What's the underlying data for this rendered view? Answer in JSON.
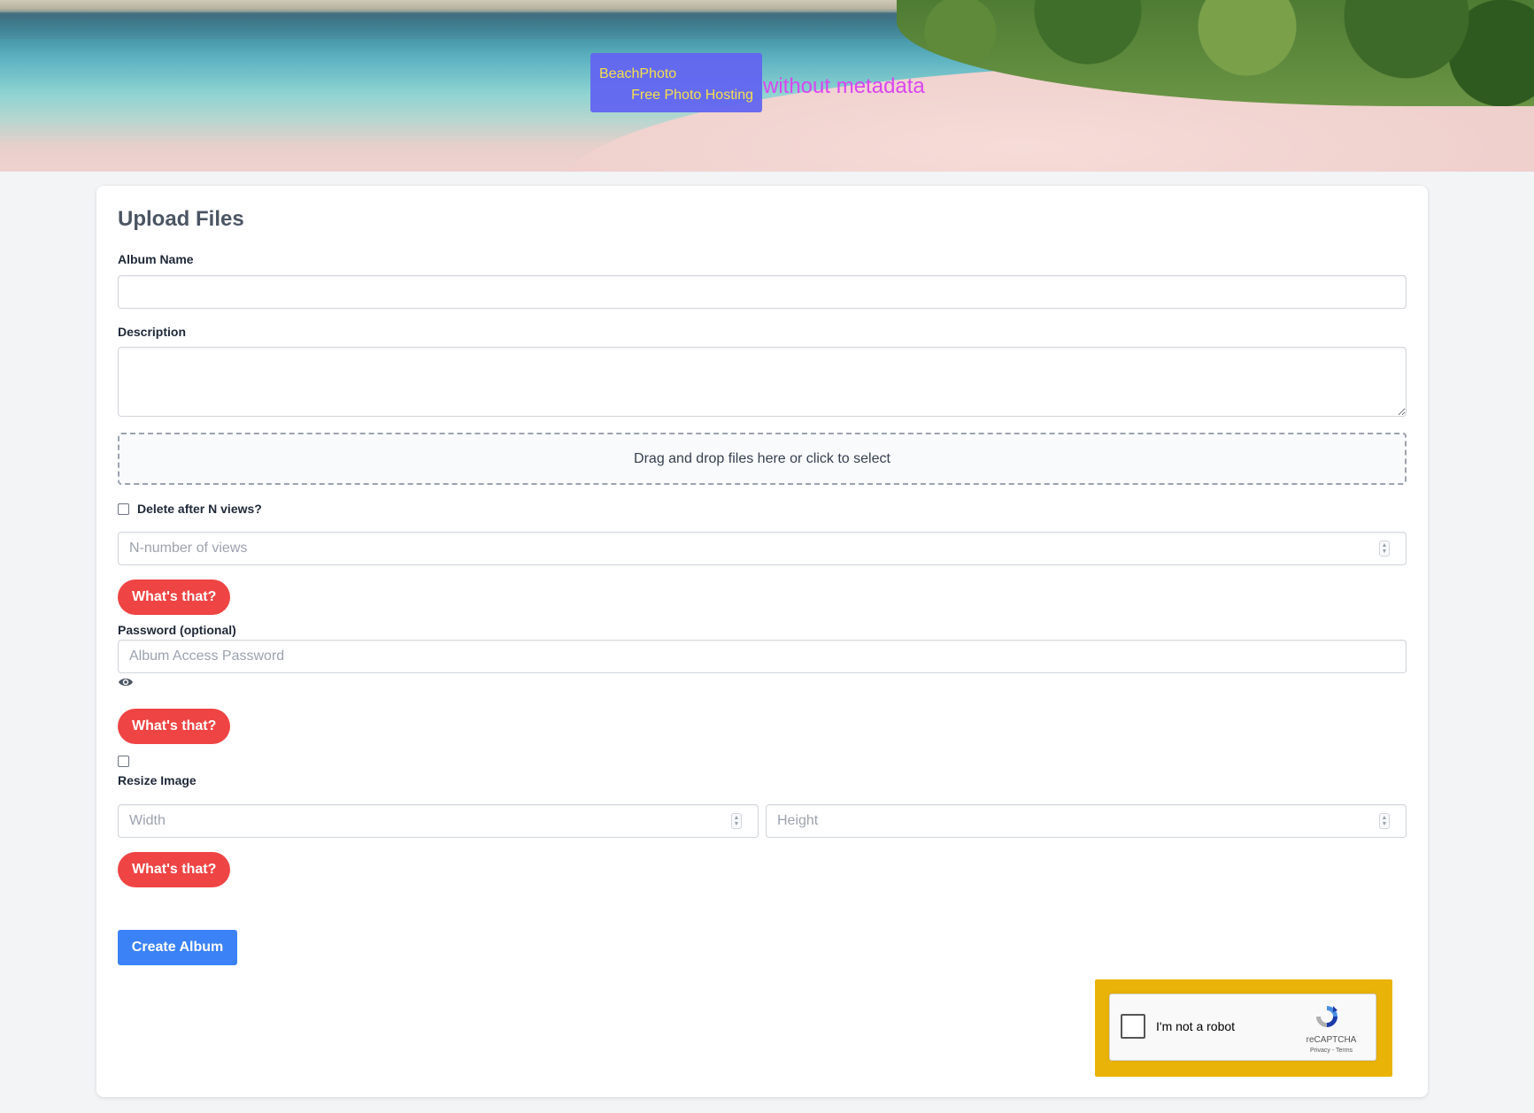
{
  "header": {
    "brand_name": "BeachPhoto",
    "brand_tagline": "Free Photo Hosting",
    "brand_suffix": "without metadata"
  },
  "form": {
    "title": "Upload Files",
    "album_name": {
      "label": "Album Name",
      "value": ""
    },
    "description": {
      "label": "Description",
      "value": ""
    },
    "dropzone_text": "Drag and drop files here or click to select",
    "delete_after": {
      "label": "Delete after N views?",
      "checked": false,
      "placeholder": "N-number of views"
    },
    "whats_that_label": "What's that?",
    "password": {
      "label": "Password (optional)",
      "placeholder": "Album Access Password"
    },
    "resize": {
      "label": "Resize Image",
      "checked": false,
      "width_placeholder": "Width",
      "height_placeholder": "Height"
    },
    "submit_label": "Create Album"
  },
  "recaptcha": {
    "label": "I'm not a robot",
    "brand": "reCAPTCHA",
    "links": "Privacy - Terms"
  },
  "colors": {
    "brand_box": "#6366f1",
    "brand_text": "#fde047",
    "brand_suffix": "#d946ef",
    "help_button": "#ef4444",
    "primary_button": "#3b82f6",
    "captcha_frame": "#eab308"
  }
}
